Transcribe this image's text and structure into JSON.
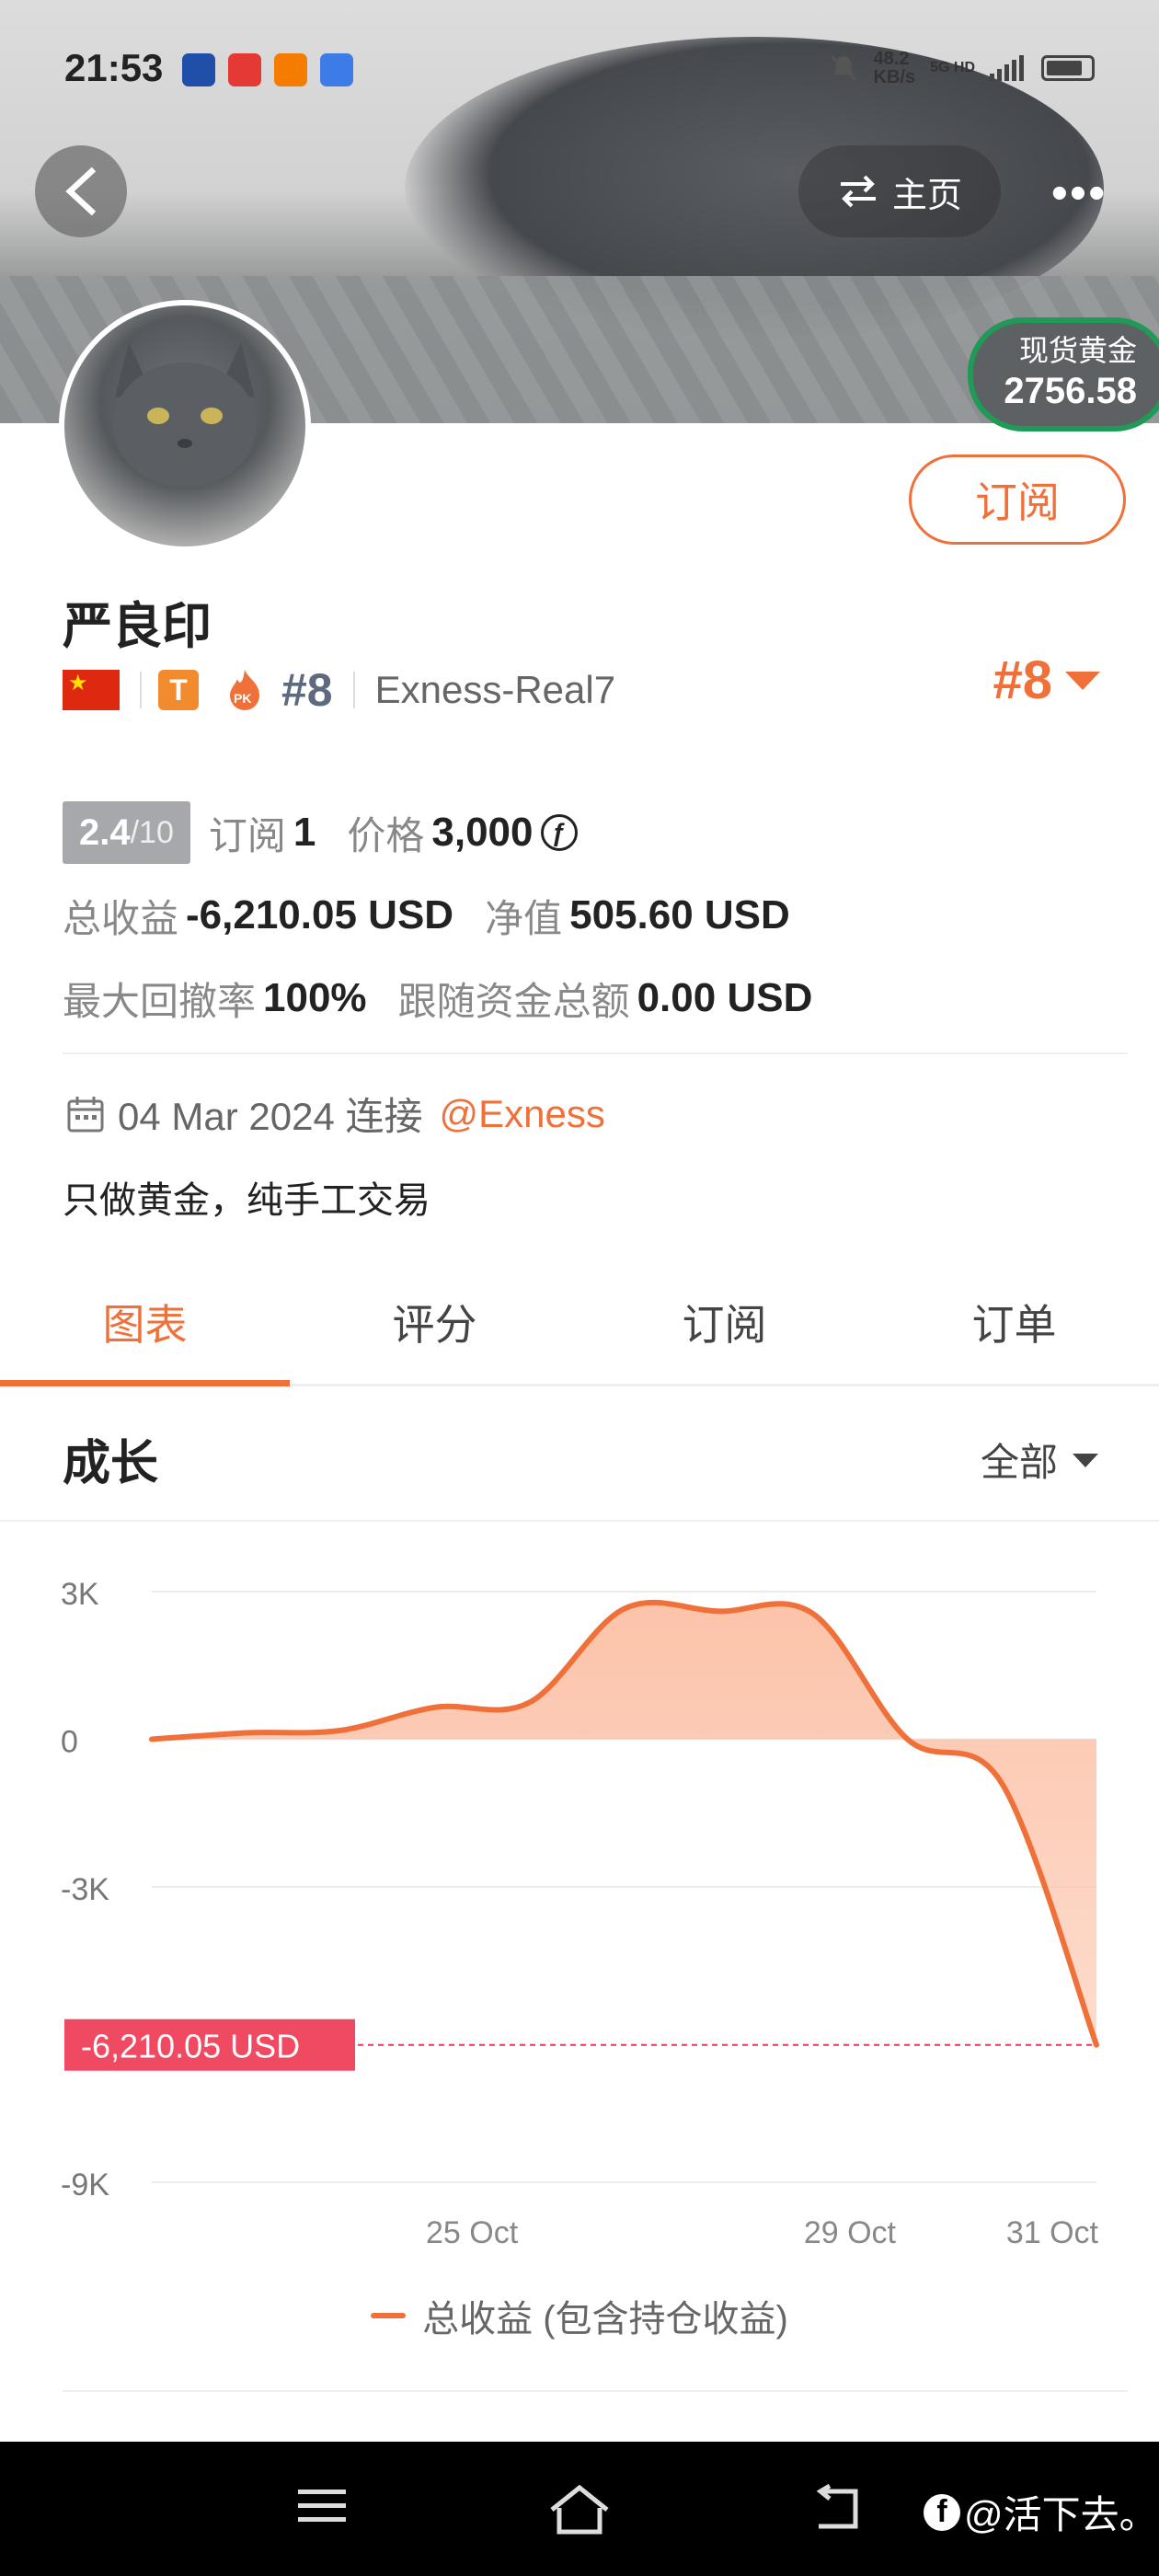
{
  "status_bar": {
    "time": "21:53",
    "net_speed": "48.2\nKB/s",
    "net_type": "5G HD"
  },
  "header": {
    "home_label": "主页",
    "more_label": "•••",
    "gold_label": "现货黄金",
    "gold_price": "2756.58"
  },
  "profile": {
    "subscribe_label": "订阅",
    "name": "严良印",
    "t_badge": "T",
    "rank_gray": "#8",
    "server": "Exness-Real7",
    "rank_orange": "#8",
    "score": "2.4",
    "score_max": "/10",
    "subs_label": "订阅",
    "subs_value": "1",
    "price_label": "价格",
    "price_value": "3,000",
    "total_profit_label": "总收益",
    "total_profit_value": "-6,210.05 USD",
    "equity_label": "净值",
    "equity_value": "505.60 USD",
    "drawdown_label": "最大回撤率",
    "drawdown_value": "100%",
    "follow_label": "跟随资金总额",
    "follow_value": "0.00 USD",
    "connect_date": "04 Mar 2024 连接",
    "broker": "@Exness",
    "bio": "只做黄金，纯手工交易"
  },
  "tabs": [
    {
      "label": "图表",
      "active": true
    },
    {
      "label": "评分",
      "active": false
    },
    {
      "label": "订阅",
      "active": false
    },
    {
      "label": "订单",
      "active": false
    }
  ],
  "section": {
    "title": "成长",
    "filter": "全部"
  },
  "chart_data": {
    "type": "area",
    "title": "成长",
    "y_ticks": [
      "3K",
      "0",
      "-3K",
      "-9K"
    ],
    "y_tick_values": [
      3000,
      0,
      -3000,
      -9000
    ],
    "ylim": [
      -9000,
      3000
    ],
    "x_ticks": [
      "25 Oct",
      "29 Oct",
      "31 Oct"
    ],
    "x_tick_index": [
      3,
      7,
      10
    ],
    "x_index": [
      0,
      1,
      2,
      3,
      4,
      5,
      6,
      7,
      8,
      9,
      10
    ],
    "series": [
      {
        "name": "总收益 (包含持仓收益)",
        "values": [
          0,
          130,
          180,
          650,
          750,
          2650,
          2600,
          2550,
          0,
          -900,
          -6210.05
        ]
      }
    ],
    "current_label": "-6,210.05 USD",
    "current_value": -6210.05,
    "colors": {
      "line": "#f0703a",
      "fill": "#fcc0a5",
      "marker": "#e8395a"
    }
  },
  "navbar": {
    "watermark": "@活下去。"
  }
}
